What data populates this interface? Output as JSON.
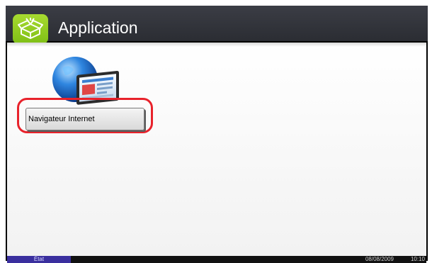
{
  "header": {
    "title": "Application",
    "icon": "application-box-icon"
  },
  "main": {
    "apps": [
      {
        "label": "Navigateur Internet",
        "icon": "internet-browser-icon",
        "highlighted": true
      }
    ]
  },
  "statusbar": {
    "status_label": "État",
    "date": "08/08/2009",
    "time": "10:10"
  },
  "colors": {
    "header_bg": "#2b2d33",
    "icon_bg": "#8cc71c",
    "highlight": "#e8222b",
    "status_tab": "#3a2f9e"
  }
}
